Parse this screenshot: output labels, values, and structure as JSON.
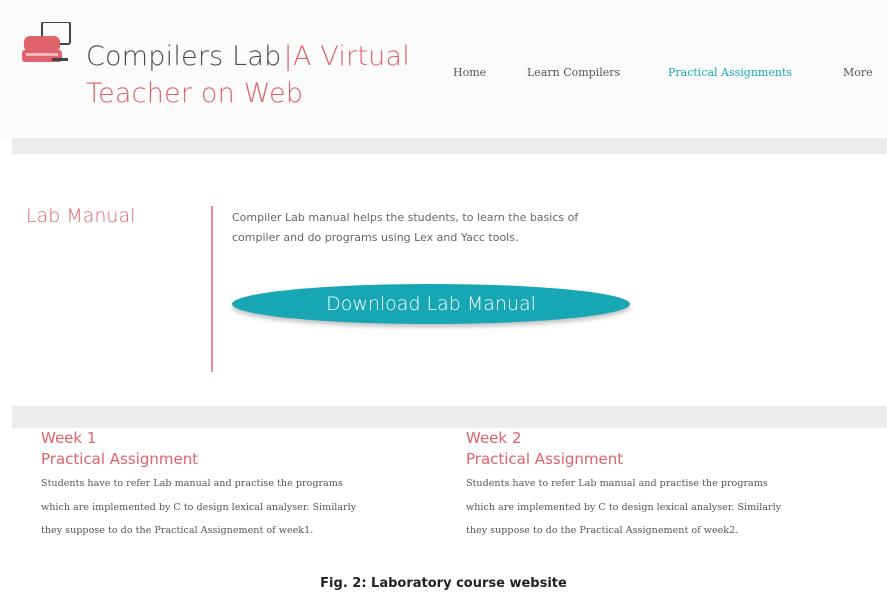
{
  "header": {
    "brand_main": "Compilers Lab",
    "brand_sep": "|",
    "brand_accent_line1": "A Virtual",
    "brand_accent_line2": "Teacher on Web",
    "logo_icon": "monitor-icon",
    "nav": [
      {
        "label": "Home",
        "active": false
      },
      {
        "label": "Learn Compilers",
        "active": false
      },
      {
        "label": "Practical Assignments",
        "active": true
      },
      {
        "label": "More",
        "active": false
      }
    ]
  },
  "lab_manual": {
    "title": "Lab Manual",
    "description_line1": "Compiler Lab manual helps the students, to learn the basics of",
    "description_line2": "compiler and do programs using Lex and Yacc tools.",
    "download_label": "Download Lab Manual"
  },
  "weeks": [
    {
      "week": "Week 1",
      "subtitle": "Practical Assignment",
      "line1": "Students have to refer Lab manual and practise the programs",
      "line2": "which are implemented by C to design lexical analyser. Similarly",
      "line3": "they suppose to do the Practical Assignement of week1."
    },
    {
      "week": "Week 2",
      "subtitle": "Practical Assignment",
      "line1": "Students have to refer Lab manual and practise the programs",
      "line2": "which are implemented by C to design lexical analyser. Similarly",
      "line3": "they suppose to do the Practical Assignement of week2."
    }
  ],
  "caption": "Fig. 2: Laboratory course website",
  "colors": {
    "accent": "#e0626a",
    "teal": "#17a7b4",
    "band": "#ececec"
  }
}
